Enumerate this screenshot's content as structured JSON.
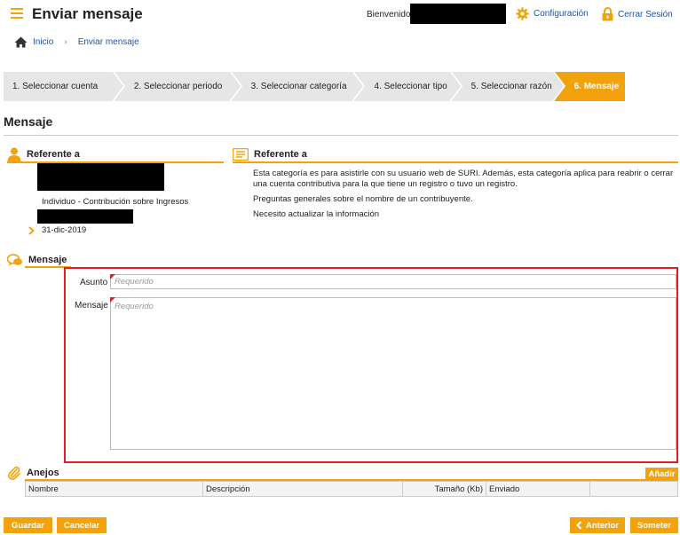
{
  "header": {
    "title": "Enviar mensaje",
    "welcome": "Bienvenido",
    "config_label": "Configuración",
    "logout_label": "Cerrar Sesión"
  },
  "breadcrumb": {
    "home": "Inicio",
    "current": "Enviar mensaje"
  },
  "steps": [
    {
      "label": "1. Seleccionar cuenta",
      "active": false
    },
    {
      "label": "2. Seleccionar periodo",
      "active": false
    },
    {
      "label": "3. Seleccionar categoría",
      "active": false
    },
    {
      "label": "4. Seleccionar tipo",
      "active": false
    },
    {
      "label": "5. Seleccionar razón",
      "active": false
    },
    {
      "label": "6. Mensaje",
      "active": true
    }
  ],
  "main": {
    "section_title": "Mensaje"
  },
  "referente_left": {
    "heading": "Referente a",
    "person_type": "Individuo - Contribución sobre Ingresos",
    "date": "31-dic-2019"
  },
  "referente_right": {
    "heading": "Referente a",
    "description": "Esta categoría es para asistirle con su usuario web de SURI. Además, esta categoría aplica para reabrir o cerrar una cuenta contributiva para la que tiene un registro o tuvo un registro.",
    "question": "Preguntas generales sobre el nombre de un contribuyente.",
    "reason": "Necesito actualizar la información"
  },
  "mensaje": {
    "heading": "Mensaje",
    "asunto_label": "Asunto",
    "asunto_placeholder": "Requerido",
    "asunto_value": "",
    "mensaje_label": "Mensaje",
    "mensaje_placeholder": "Requerido",
    "mensaje_value": ""
  },
  "anejos": {
    "heading": "Anejos",
    "add_label": "Añadir",
    "columns": [
      "Nombre",
      "Descripción",
      "Tamaño (Kb)",
      "Enviado"
    ]
  },
  "footer": {
    "save_label": "Guardar",
    "cancel_label": "Cancelar",
    "prev_label": "Anterior",
    "submit_label": "Someter"
  },
  "colors": {
    "accent": "#f2a20c",
    "link": "#1a56b0",
    "highlight": "#e02020"
  }
}
